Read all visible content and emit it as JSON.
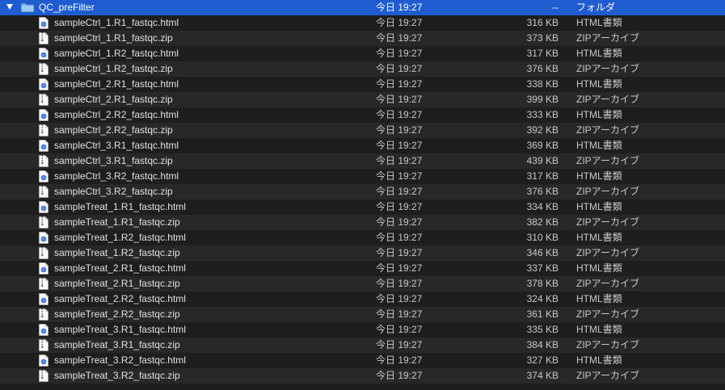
{
  "folder": {
    "name": "QC_preFilter",
    "date": "今日 19:27",
    "size": "--",
    "kind": "フォルダ"
  },
  "files": [
    {
      "name": "sampleCtrl_1.R1_fastqc.html",
      "date": "今日 19:27",
      "size": "316 KB",
      "kind": "HTML書類",
      "icon": "html-document-icon"
    },
    {
      "name": "sampleCtrl_1.R1_fastqc.zip",
      "date": "今日 19:27",
      "size": "373 KB",
      "kind": "ZIPアーカイブ",
      "icon": "zip-archive-icon"
    },
    {
      "name": "sampleCtrl_1.R2_fastqc.html",
      "date": "今日 19:27",
      "size": "317 KB",
      "kind": "HTML書類",
      "icon": "html-document-icon"
    },
    {
      "name": "sampleCtrl_1.R2_fastqc.zip",
      "date": "今日 19:27",
      "size": "376 KB",
      "kind": "ZIPアーカイブ",
      "icon": "zip-archive-icon"
    },
    {
      "name": "sampleCtrl_2.R1_fastqc.html",
      "date": "今日 19:27",
      "size": "338 KB",
      "kind": "HTML書類",
      "icon": "html-document-icon"
    },
    {
      "name": "sampleCtrl_2.R1_fastqc.zip",
      "date": "今日 19:27",
      "size": "399 KB",
      "kind": "ZIPアーカイブ",
      "icon": "zip-archive-icon"
    },
    {
      "name": "sampleCtrl_2.R2_fastqc.html",
      "date": "今日 19:27",
      "size": "333 KB",
      "kind": "HTML書類",
      "icon": "html-document-icon"
    },
    {
      "name": "sampleCtrl_2.R2_fastqc.zip",
      "date": "今日 19:27",
      "size": "392 KB",
      "kind": "ZIPアーカイブ",
      "icon": "zip-archive-icon"
    },
    {
      "name": "sampleCtrl_3.R1_fastqc.html",
      "date": "今日 19:27",
      "size": "369 KB",
      "kind": "HTML書類",
      "icon": "html-document-icon"
    },
    {
      "name": "sampleCtrl_3.R1_fastqc.zip",
      "date": "今日 19:27",
      "size": "439 KB",
      "kind": "ZIPアーカイブ",
      "icon": "zip-archive-icon"
    },
    {
      "name": "sampleCtrl_3.R2_fastqc.html",
      "date": "今日 19:27",
      "size": "317 KB",
      "kind": "HTML書類",
      "icon": "html-document-icon"
    },
    {
      "name": "sampleCtrl_3.R2_fastqc.zip",
      "date": "今日 19:27",
      "size": "376 KB",
      "kind": "ZIPアーカイブ",
      "icon": "zip-archive-icon"
    },
    {
      "name": "sampleTreat_1.R1_fastqc.html",
      "date": "今日 19:27",
      "size": "334 KB",
      "kind": "HTML書類",
      "icon": "html-document-icon"
    },
    {
      "name": "sampleTreat_1.R1_fastqc.zip",
      "date": "今日 19:27",
      "size": "382 KB",
      "kind": "ZIPアーカイブ",
      "icon": "zip-archive-icon"
    },
    {
      "name": "sampleTreat_1.R2_fastqc.html",
      "date": "今日 19:27",
      "size": "310 KB",
      "kind": "HTML書類",
      "icon": "html-document-icon"
    },
    {
      "name": "sampleTreat_1.R2_fastqc.zip",
      "date": "今日 19:27",
      "size": "346 KB",
      "kind": "ZIPアーカイブ",
      "icon": "zip-archive-icon"
    },
    {
      "name": "sampleTreat_2.R1_fastqc.html",
      "date": "今日 19:27",
      "size": "337 KB",
      "kind": "HTML書類",
      "icon": "html-document-icon"
    },
    {
      "name": "sampleTreat_2.R1_fastqc.zip",
      "date": "今日 19:27",
      "size": "378 KB",
      "kind": "ZIPアーカイブ",
      "icon": "zip-archive-icon"
    },
    {
      "name": "sampleTreat_2.R2_fastqc.html",
      "date": "今日 19:27",
      "size": "324 KB",
      "kind": "HTML書類",
      "icon": "html-document-icon"
    },
    {
      "name": "sampleTreat_2.R2_fastqc.zip",
      "date": "今日 19:27",
      "size": "361 KB",
      "kind": "ZIPアーカイブ",
      "icon": "zip-archive-icon"
    },
    {
      "name": "sampleTreat_3.R1_fastqc.html",
      "date": "今日 19:27",
      "size": "335 KB",
      "kind": "HTML書類",
      "icon": "html-document-icon"
    },
    {
      "name": "sampleTreat_3.R1_fastqc.zip",
      "date": "今日 19:27",
      "size": "384 KB",
      "kind": "ZIPアーカイブ",
      "icon": "zip-archive-icon"
    },
    {
      "name": "sampleTreat_3.R2_fastqc.html",
      "date": "今日 19:27",
      "size": "327 KB",
      "kind": "HTML書類",
      "icon": "html-document-icon"
    },
    {
      "name": "sampleTreat_3.R2_fastqc.zip",
      "date": "今日 19:27",
      "size": "374 KB",
      "kind": "ZIPアーカイブ",
      "icon": "zip-archive-icon"
    }
  ],
  "colors": {
    "selection": "#1f5ccf",
    "row_even": "#1e1e1e",
    "row_odd": "#282828",
    "text": "#e0e0e0",
    "html_icon_badge": "#3b6fd4"
  }
}
